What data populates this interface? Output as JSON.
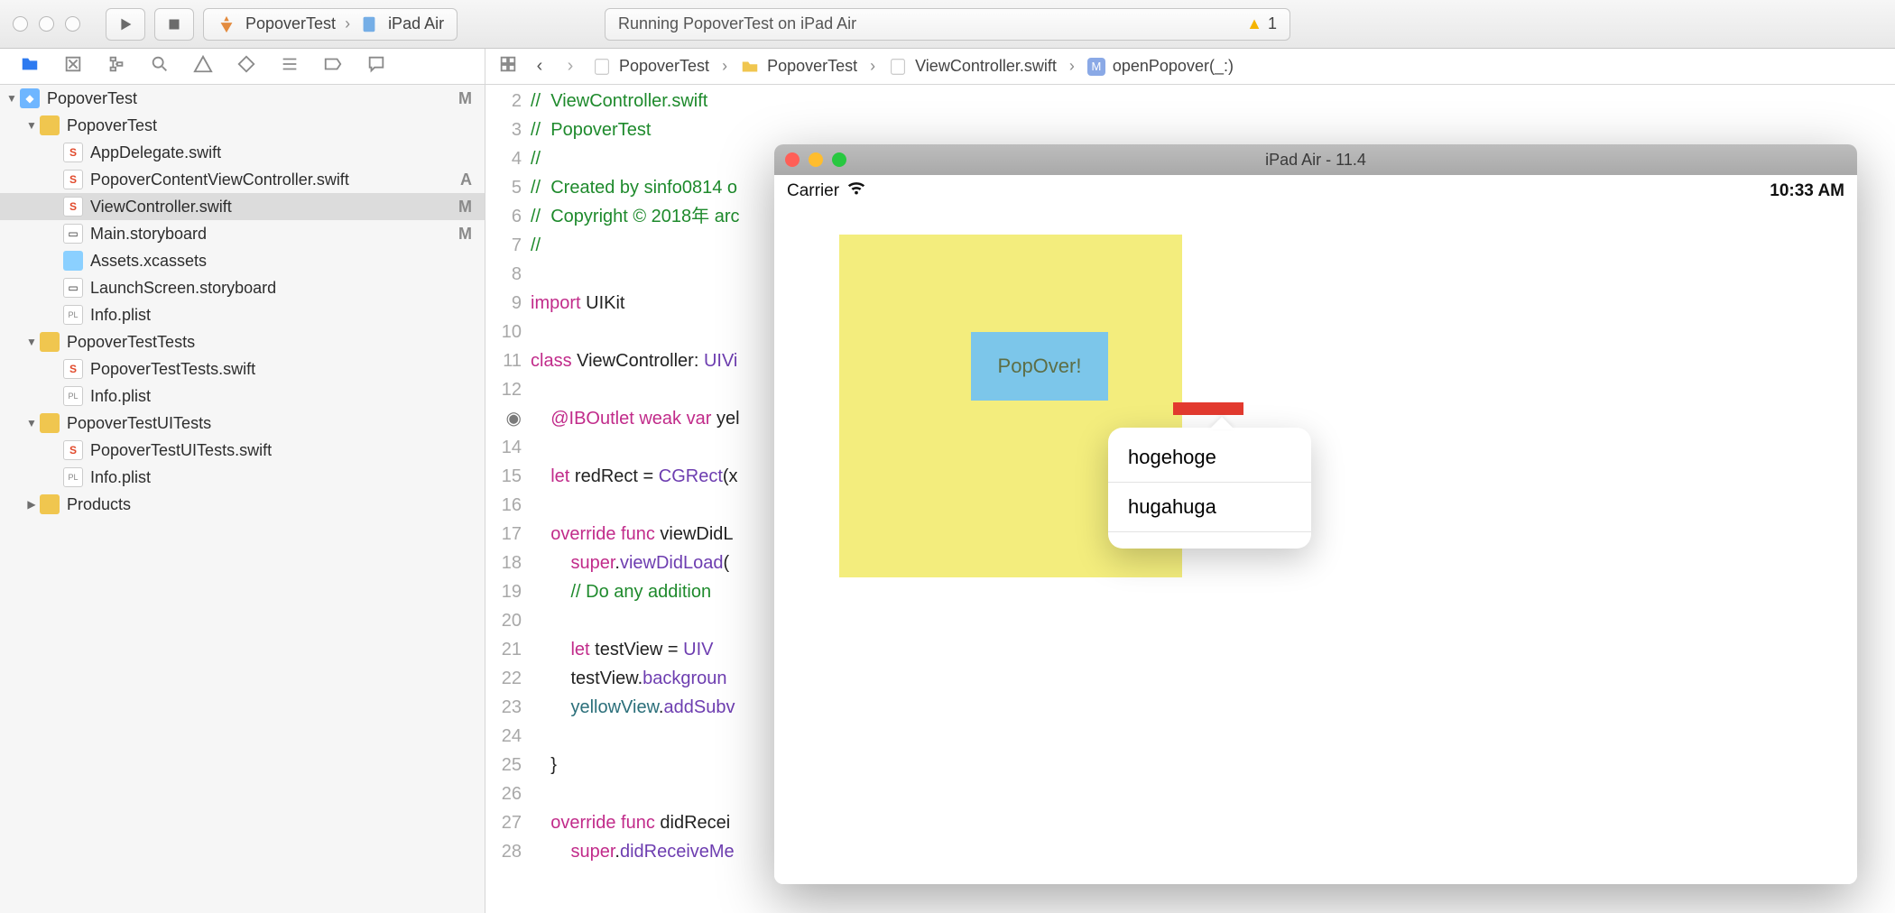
{
  "toolbar": {
    "scheme_project": "PopoverTest",
    "scheme_device": "iPad Air",
    "status_text": "Running PopoverTest on iPad Air",
    "warning_count": "1"
  },
  "jumpbar": {
    "items": [
      "PopoverTest",
      "PopoverTest",
      "ViewController.swift",
      "openPopover(_:)"
    ]
  },
  "navigator": {
    "root": "PopoverTest",
    "group1": "PopoverTest",
    "files1": [
      {
        "name": "AppDelegate.swift",
        "status": ""
      },
      {
        "name": "PopoverContentViewController.swift",
        "status": "A"
      },
      {
        "name": "ViewController.swift",
        "status": "M",
        "selected": true
      },
      {
        "name": "Main.storyboard",
        "status": "M"
      },
      {
        "name": "Assets.xcassets",
        "status": ""
      },
      {
        "name": "LaunchScreen.storyboard",
        "status": ""
      },
      {
        "name": "Info.plist",
        "status": ""
      }
    ],
    "group2": "PopoverTestTests",
    "files2": [
      {
        "name": "PopoverTestTests.swift"
      },
      {
        "name": "Info.plist"
      }
    ],
    "group3": "PopoverTestUITests",
    "files3": [
      {
        "name": "PopoverTestUITests.swift"
      },
      {
        "name": "Info.plist"
      }
    ],
    "group4": "Products",
    "root_status": "M"
  },
  "code": {
    "lines": {
      "2": "//  ViewController.swift",
      "3": "//  PopoverTest",
      "4": "//",
      "5": "//  Created by sinfo0814 o",
      "6": "//  Copyright © 2018年 arc",
      "7": "//",
      "8": "",
      "9_a": "import",
      "9_b": " UIKit",
      "10": "",
      "11_a": "class",
      "11_b": " ViewController: ",
      "11_c": "UIVi",
      "12": "",
      "13_a": "    @IBOutlet",
      "13_b": " weak",
      "13_c": " var",
      "13_d": " yel",
      "14": "",
      "15_a": "    let",
      "15_b": " redRect = ",
      "15_c": "CGRect",
      "15_d": "(x",
      "16": "",
      "17_a": "    override",
      "17_b": " func",
      "17_c": " viewDidL",
      "18_a": "        super",
      "18_b": ".",
      "18_c": "viewDidLoad",
      "18_d": "(",
      "19": "        // Do any addition",
      "20": "",
      "21_a": "        let",
      "21_b": " testView = ",
      "21_c": "UIV",
      "22_a": "        testView.",
      "22_b": "backgroun",
      "23_a": "        yellowView.",
      "23_b": "addSubv",
      "24": "",
      "25": "    }",
      "26": "",
      "27_a": "    override",
      "27_b": " func",
      "27_c": " didRecei",
      "28_a": "        super",
      "28_b": ".",
      "28_c": "didReceiveMe"
    }
  },
  "simulator": {
    "title": "iPad Air - 11.4",
    "carrier": "Carrier",
    "clock": "10:33 AM",
    "button_label": "PopOver!",
    "popover_rows": [
      "hogehoge",
      "hugahuga"
    ]
  }
}
